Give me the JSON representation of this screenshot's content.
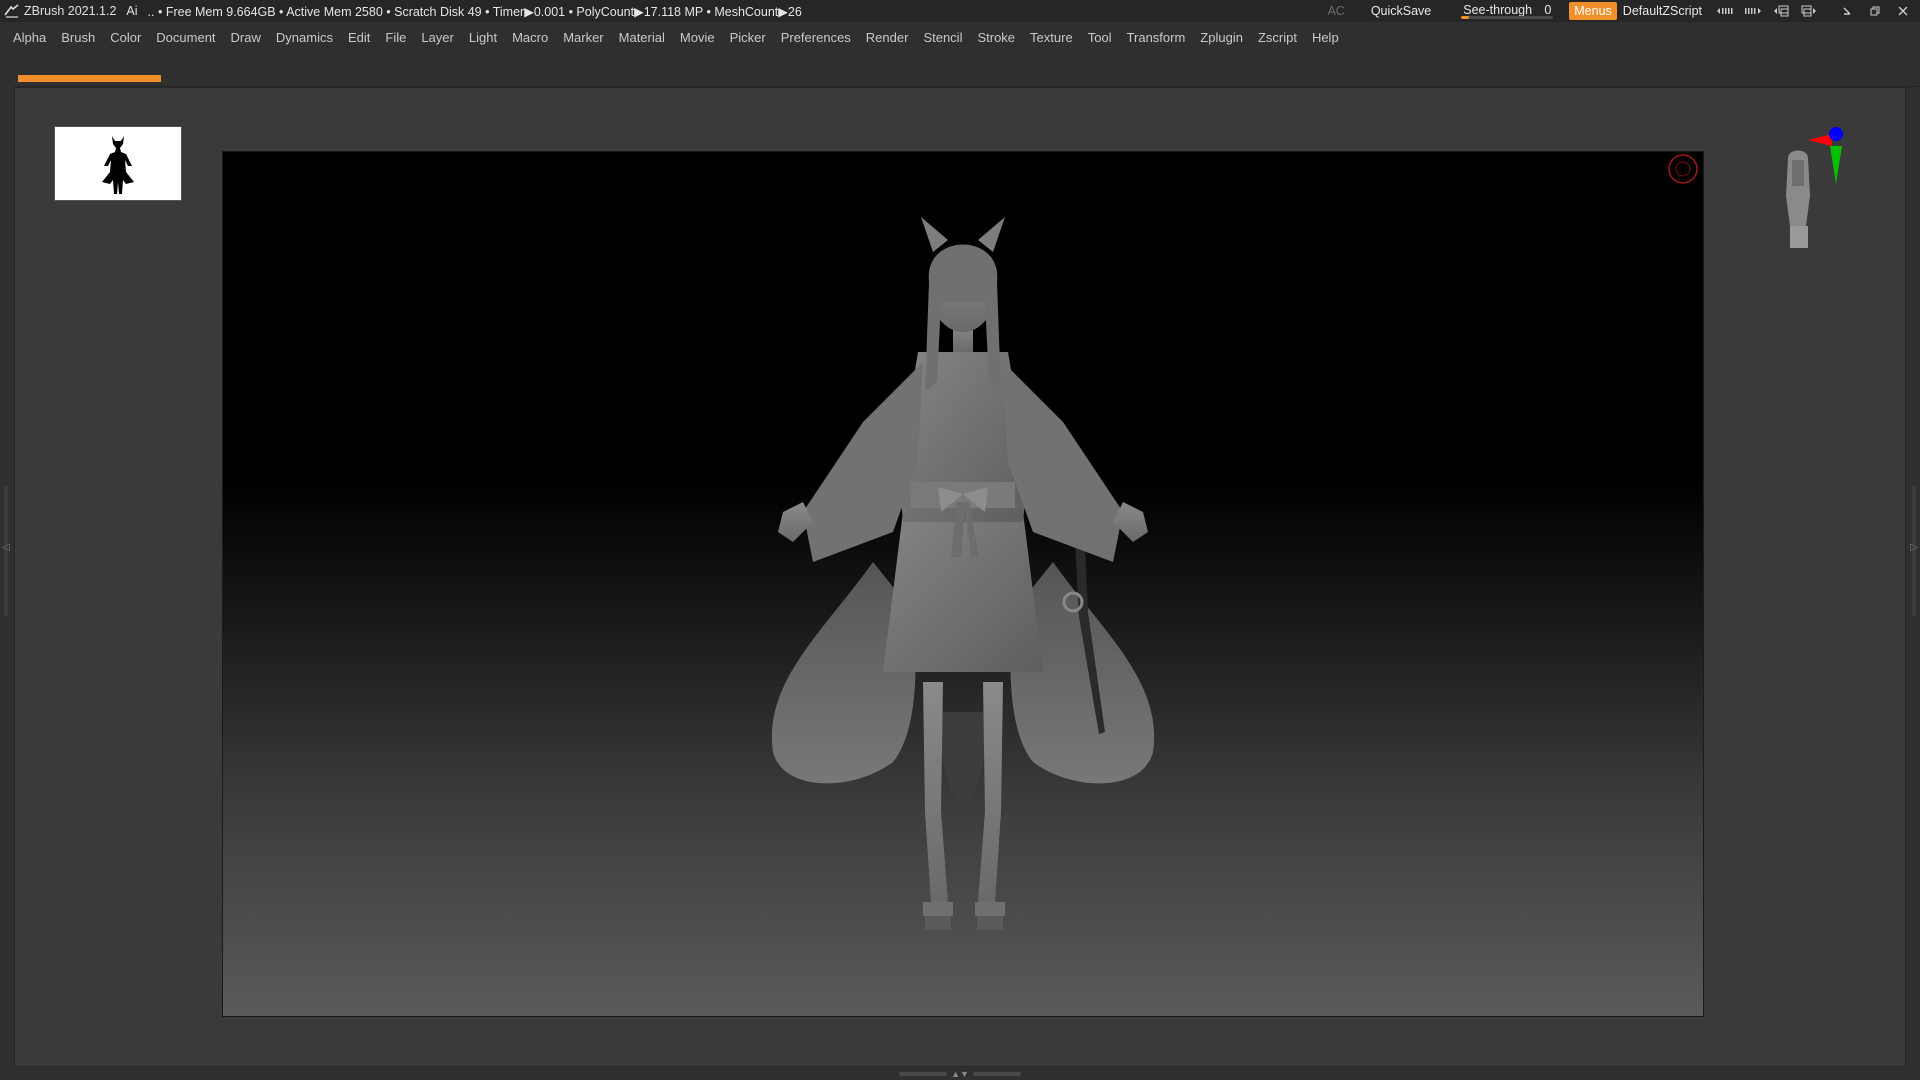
{
  "title_bar": {
    "app_title": "ZBrush 2021.1.2",
    "ai_label": "Ai",
    "status_text": ".. • Free Mem 9.664GB • Active Mem 2580 • Scratch Disk 49 •  Timer▶0.001 • PolyCount▶17.118 MP  • MeshCount▶26",
    "ac_label": "AC",
    "quicksave_label": "QuickSave",
    "seethrough_label": "See-through",
    "seethrough_value": "0",
    "seethrough_fraction": 0.0,
    "menus_label": "Menus",
    "default_zscript_label": "DefaultZScript",
    "window_icons": [
      "layout-prev-icon",
      "layout-next-icon",
      "window-layout-icon",
      "restore-layout-icon",
      "minimize-icon",
      "maximize-icon",
      "close-icon"
    ]
  },
  "menu_bar": {
    "items": [
      "Alpha",
      "Brush",
      "Color",
      "Document",
      "Draw",
      "Dynamics",
      "Edit",
      "File",
      "Layer",
      "Light",
      "Macro",
      "Marker",
      "Material",
      "Movie",
      "Picker",
      "Preferences",
      "Render",
      "Stencil",
      "Stroke",
      "Texture",
      "Tool",
      "Transform",
      "Zplugin",
      "Zscript",
      "Help"
    ]
  },
  "colors": {
    "accent": "#f0902a",
    "background": "#2f2f2f",
    "canvas_top": "#000000",
    "canvas_bottom": "#5a5a5a",
    "gizmo_x": "#ff0000",
    "gizmo_y": "#00cc00",
    "gizmo_z": "#0000ff"
  },
  "canvas": {
    "model_icon": "fox-girl-sculpt-icon",
    "thumbnail_icon": "silhouette-thumbnail-icon",
    "rec_icon": "record-icon"
  }
}
